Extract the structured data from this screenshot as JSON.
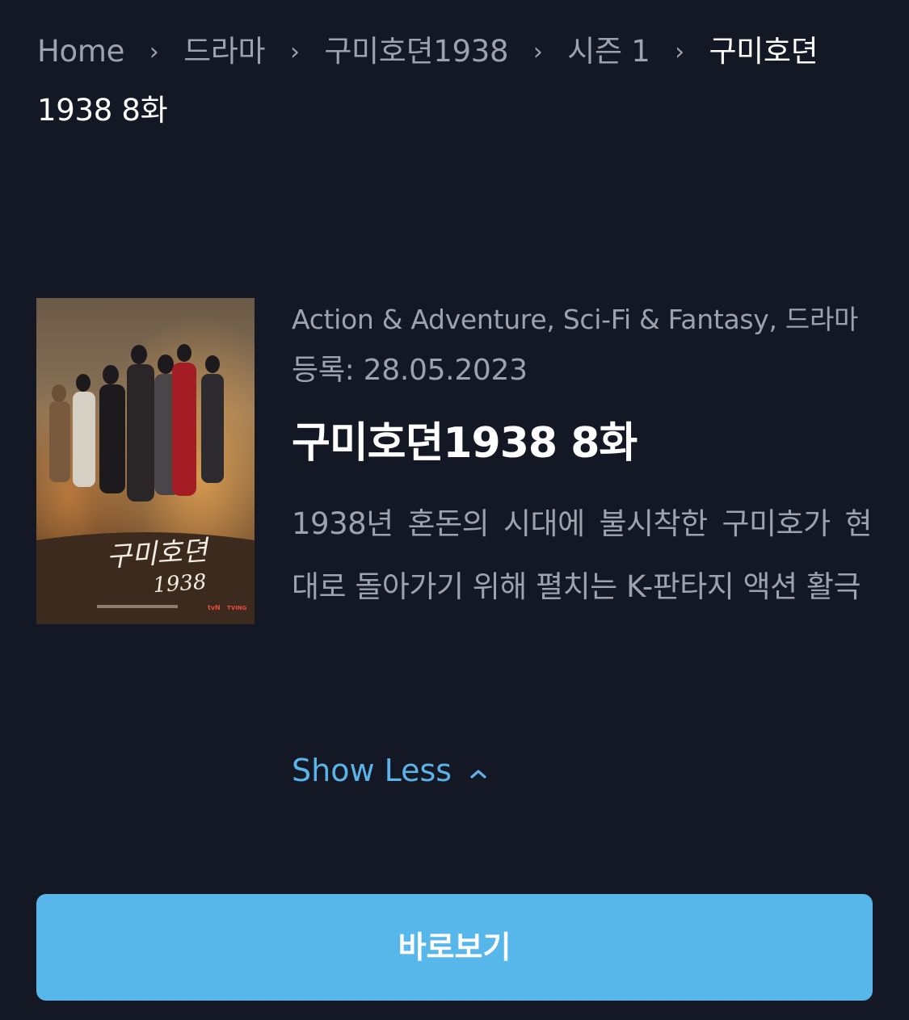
{
  "breadcrumb": {
    "items": [
      "Home",
      "드라마",
      "구미호뎐1938",
      "시즌 1"
    ],
    "current": "구미호뎐 1938 8화",
    "separator": "›"
  },
  "poster": {
    "title_line1": "구미호뎐",
    "title_line2": "1938",
    "network": "tvN",
    "platform": "TVING"
  },
  "episode": {
    "genres": "Action & Adventure, Sci-Fi & Fantasy, 드라마",
    "registered": "등록: 28.05.2023",
    "title": "구미호뎐1938 8화",
    "description": "1938년 혼돈의 시대에 불시착한 구미호가 현대로 돌아가기 위해 펼치는 K-판타지 액션 활극"
  },
  "show_less": {
    "label": "Show Less",
    "icon": "chevron-up-icon"
  },
  "watch_button": {
    "label": "바로보기"
  },
  "colors": {
    "background": "#141724",
    "accent": "#5ab4e8",
    "button": "#57b6ea",
    "muted_text": "#9ea2ad"
  }
}
